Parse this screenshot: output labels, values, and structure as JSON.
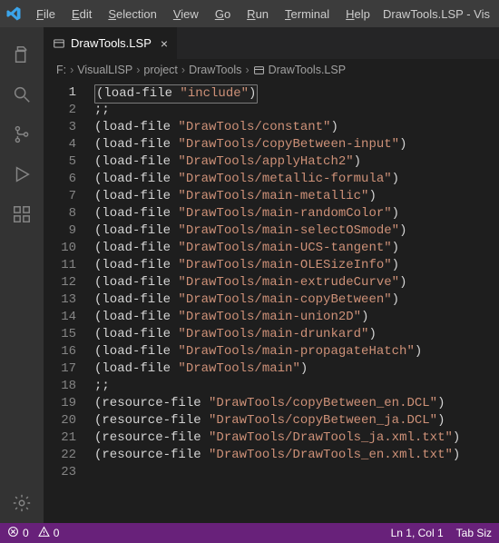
{
  "titlebar": {
    "title": "DrawTools.LSP - Vis"
  },
  "menu": {
    "file": "File",
    "edit": "Edit",
    "selection": "Selection",
    "view": "View",
    "go": "Go",
    "run": "Run",
    "terminal": "Terminal",
    "help": "Help"
  },
  "tab": {
    "label": "DrawTools.LSP",
    "close": "×"
  },
  "breadcrumb": {
    "sep": "›",
    "items": [
      "F:",
      "VisualLISP",
      "project",
      "DrawTools",
      "DrawTools.LSP"
    ]
  },
  "code": {
    "lines": [
      {
        "n": "1",
        "kind": "load-boxed",
        "fn": "load-file",
        "str": "\"include\""
      },
      {
        "n": "2",
        "kind": "comment",
        "text": ";;"
      },
      {
        "n": "3",
        "kind": "load",
        "fn": "load-file",
        "str": "\"DrawTools/constant\""
      },
      {
        "n": "4",
        "kind": "load",
        "fn": "load-file",
        "str": "\"DrawTools/copyBetween-input\""
      },
      {
        "n": "5",
        "kind": "load",
        "fn": "load-file",
        "str": "\"DrawTools/applyHatch2\""
      },
      {
        "n": "6",
        "kind": "load",
        "fn": "load-file",
        "str": "\"DrawTools/metallic-formula\""
      },
      {
        "n": "7",
        "kind": "load",
        "fn": "load-file",
        "str": "\"DrawTools/main-metallic\""
      },
      {
        "n": "8",
        "kind": "load",
        "fn": "load-file",
        "str": "\"DrawTools/main-randomColor\""
      },
      {
        "n": "9",
        "kind": "load",
        "fn": "load-file",
        "str": "\"DrawTools/main-selectOSmode\""
      },
      {
        "n": "10",
        "kind": "load",
        "fn": "load-file",
        "str": "\"DrawTools/main-UCS-tangent\""
      },
      {
        "n": "11",
        "kind": "load",
        "fn": "load-file",
        "str": "\"DrawTools/main-OLESizeInfo\""
      },
      {
        "n": "12",
        "kind": "load",
        "fn": "load-file",
        "str": "\"DrawTools/main-extrudeCurve\""
      },
      {
        "n": "13",
        "kind": "load",
        "fn": "load-file",
        "str": "\"DrawTools/main-copyBetween\""
      },
      {
        "n": "14",
        "kind": "load",
        "fn": "load-file",
        "str": "\"DrawTools/main-union2D\""
      },
      {
        "n": "15",
        "kind": "load",
        "fn": "load-file",
        "str": "\"DrawTools/main-drunkard\""
      },
      {
        "n": "16",
        "kind": "load",
        "fn": "load-file",
        "str": "\"DrawTools/main-propagateHatch\""
      },
      {
        "n": "17",
        "kind": "load",
        "fn": "load-file",
        "str": "\"DrawTools/main\""
      },
      {
        "n": "18",
        "kind": "comment",
        "text": ";;"
      },
      {
        "n": "19",
        "kind": "res",
        "fn": "resource-file",
        "str": "\"DrawTools/copyBetween_en.DCL\""
      },
      {
        "n": "20",
        "kind": "res",
        "fn": "resource-file",
        "str": "\"DrawTools/copyBetween_ja.DCL\""
      },
      {
        "n": "21",
        "kind": "res",
        "fn": "resource-file",
        "str": "\"DrawTools/DrawTools_ja.xml.txt\""
      },
      {
        "n": "22",
        "kind": "res",
        "fn": "resource-file",
        "str": "\"DrawTools/DrawTools_en.xml.txt\""
      },
      {
        "n": "23",
        "kind": "blank"
      }
    ]
  },
  "statusbar": {
    "errors": "0",
    "warnings": "0",
    "lncol": "Ln 1, Col 1",
    "tabsize": "Tab Siz"
  }
}
